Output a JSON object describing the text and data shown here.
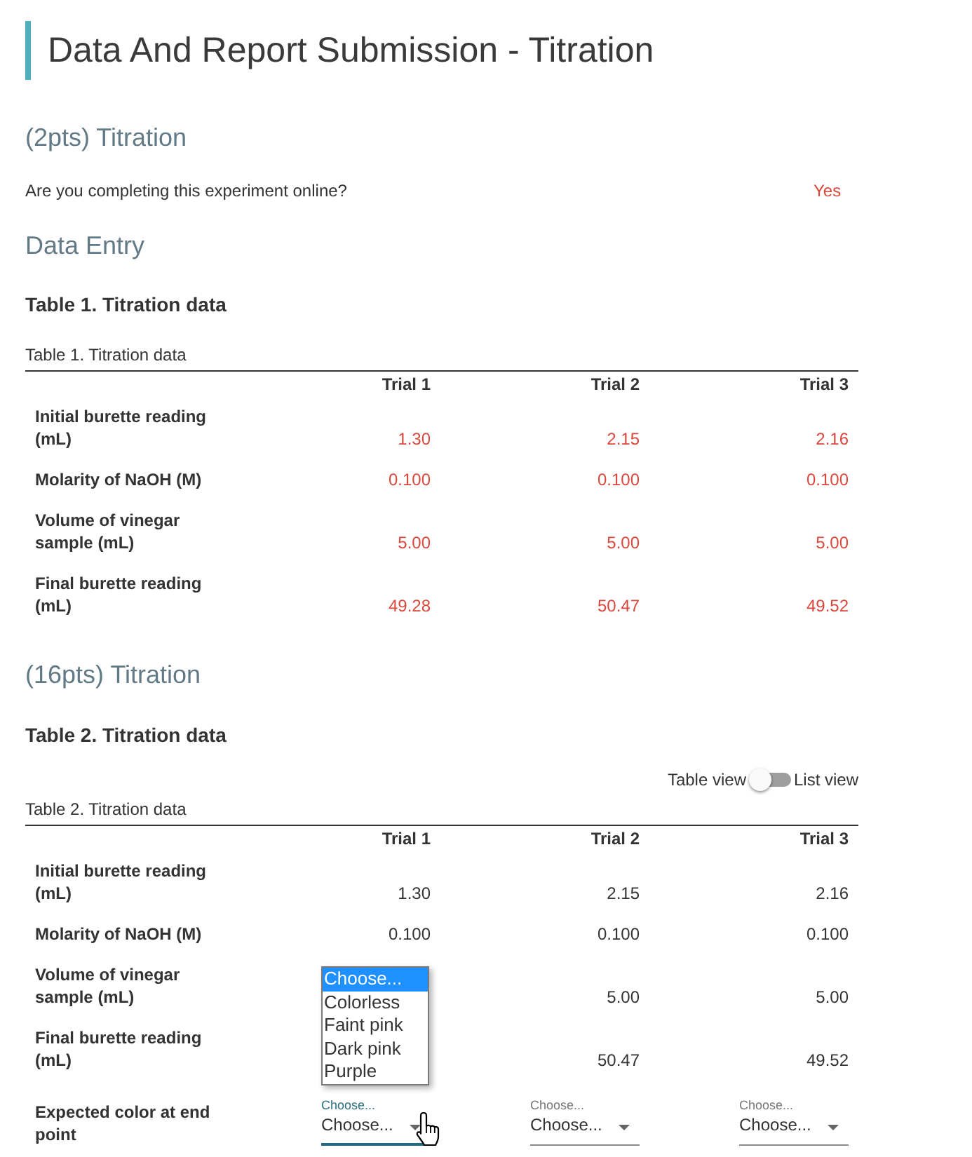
{
  "title": "Data And Report Submission - Titration",
  "part_1": {
    "heading": "(2pts) Titration",
    "question": {
      "prompt": "Are you completing this experiment online?",
      "answer": "Yes"
    }
  },
  "data_entry": {
    "heading": "Data Entry",
    "table_title": "Table 1. Titration data",
    "table": {
      "caption": "Table 1. Titration data",
      "submitted": true,
      "columns": [
        "Trial 1",
        "Trial 2",
        "Trial 3"
      ],
      "rows": [
        {
          "kind": "values",
          "label": "Initial burette reading (mL)",
          "cells": {
            "trial_1": "1.30",
            "trial_2": "2.15",
            "trial_3": "2.16"
          }
        },
        {
          "kind": "values",
          "label": "Molarity of NaOH (M)",
          "cells": {
            "trial_1": "0.100",
            "trial_2": "0.100",
            "trial_3": "0.100"
          }
        },
        {
          "kind": "values",
          "label": "Volume of vinegar sample (mL)",
          "cells": {
            "trial_1": "5.00",
            "trial_2": "5.00",
            "trial_3": "5.00"
          }
        },
        {
          "kind": "values",
          "label": "Final burette reading (mL)",
          "cells": {
            "trial_1": "49.28",
            "trial_2": "50.47",
            "trial_3": "49.52"
          }
        }
      ]
    }
  },
  "part_2": {
    "heading": "(16pts) Titration",
    "table_title": "Table 2. Titration data",
    "view_toggle": {
      "left_label": "Table view",
      "right_label": "List view",
      "on": false
    },
    "table": {
      "caption": "Table 2. Titration data",
      "submitted": false,
      "columns": [
        "Trial 1",
        "Trial 2",
        "Trial 3"
      ],
      "rows": [
        {
          "kind": "values",
          "label": "Initial burette reading (mL)",
          "cells": {
            "trial_1": "1.30",
            "trial_2": "2.15",
            "trial_3": "2.16"
          }
        },
        {
          "kind": "values",
          "label": "Molarity of NaOH (M)",
          "cells": {
            "trial_1": "0.100",
            "trial_2": "0.100",
            "trial_3": "0.100"
          }
        },
        {
          "kind": "values",
          "label": "Volume of vinegar sample (mL)",
          "cells": {
            "trial_2": "5.00",
            "trial_3": "5.00"
          }
        },
        {
          "kind": "values",
          "label": "Final burette reading (mL)",
          "cells": {
            "trial_2": "50.47",
            "trial_3": "49.52"
          }
        },
        {
          "kind": "select",
          "label": "Expected color at end point",
          "selects": [
            {
              "label": "Choose...",
              "value": "Choose...",
              "focused": true,
              "options": [
                {
                  "text": "Choose...",
                  "selected": true
                },
                {
                  "text": "Colorless",
                  "selected": false
                },
                {
                  "text": "Faint pink",
                  "selected": false
                },
                {
                  "text": "Dark pink",
                  "selected": false
                },
                {
                  "text": "Purple",
                  "selected": false
                }
              ]
            },
            {
              "label": "Choose...",
              "value": "Choose...",
              "focused": false
            },
            {
              "label": "Choose...",
              "value": "Choose...",
              "focused": false
            }
          ]
        }
      ]
    }
  }
}
